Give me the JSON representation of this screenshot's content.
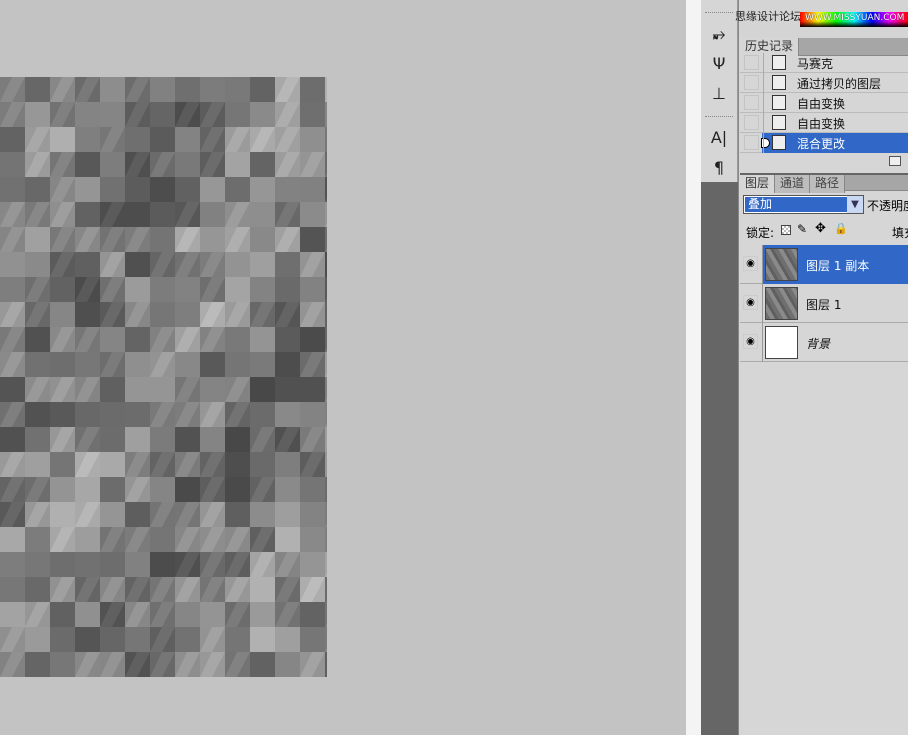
{
  "watermark": {
    "cn": "思缘设计论坛",
    "url": "WWW.MISSYUAN.COM"
  },
  "colors": {
    "selection": "#3167c6",
    "canvas_bg": "#c3c3c3"
  },
  "tools": [
    {
      "icon": "smudge-icon",
      "glyph": "⥵"
    },
    {
      "icon": "brush-preset-icon",
      "glyph": "Ψ"
    },
    {
      "icon": "clone-source-icon",
      "glyph": "⊥"
    },
    {
      "icon": "character-icon",
      "glyph": "A|"
    },
    {
      "icon": "paragraph-icon",
      "glyph": "¶"
    }
  ],
  "history": {
    "tab": "历史记录",
    "items": [
      {
        "label": "马赛克"
      },
      {
        "label": "通过拷贝的图层"
      },
      {
        "label": "自由变换"
      },
      {
        "label": "自由变换"
      },
      {
        "label": "混合更改"
      }
    ],
    "selected_index": 4
  },
  "layers": {
    "tabs": [
      "图层",
      "通道",
      "路径"
    ],
    "blend_mode": "叠加",
    "opacity_label": "不透明度",
    "lock_label": "锁定:",
    "fill_label": "填充",
    "items": [
      {
        "name": "图层 1 副本",
        "visible": true,
        "selected": true
      },
      {
        "name": "图层 1",
        "visible": true
      },
      {
        "name": "背景",
        "visible": true
      }
    ]
  }
}
